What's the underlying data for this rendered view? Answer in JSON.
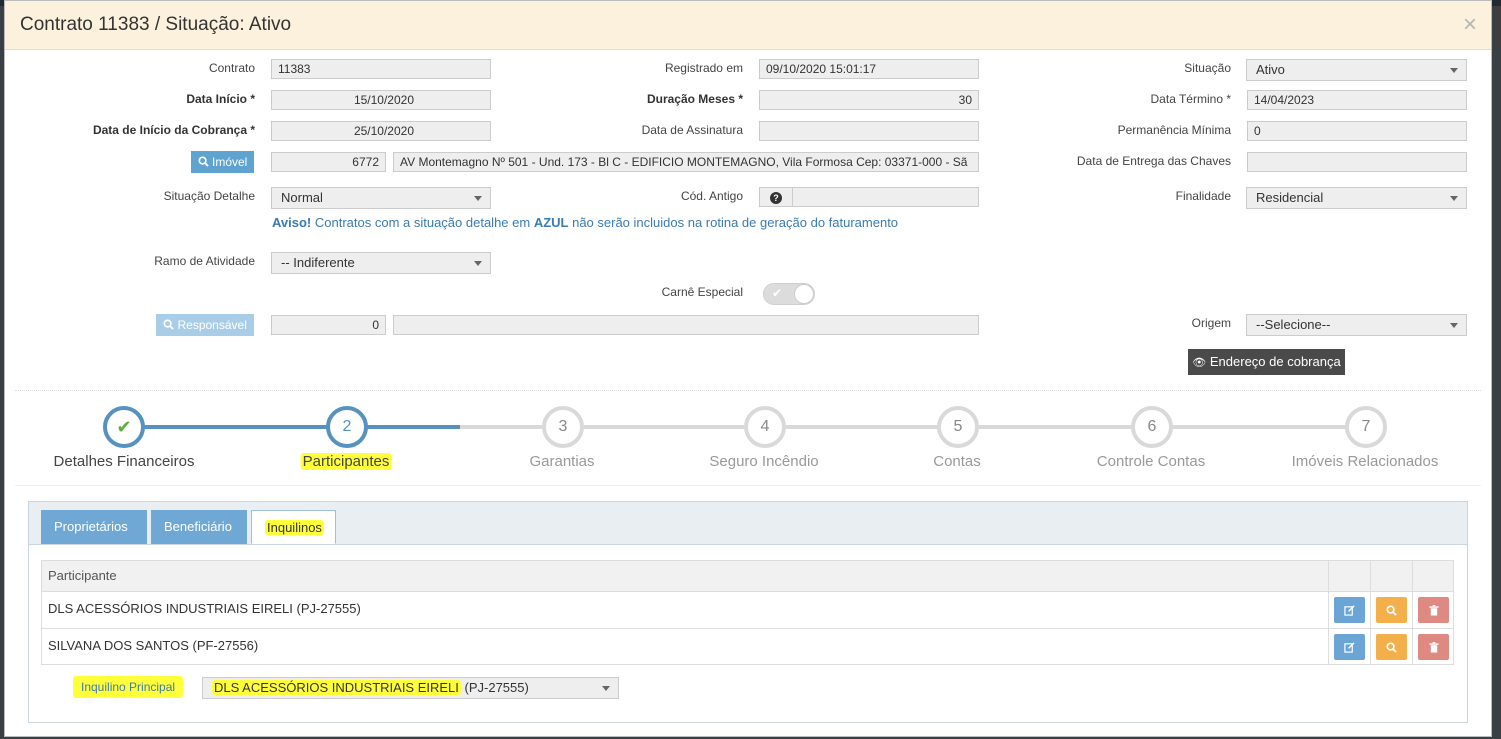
{
  "modal": {
    "title": "Contrato 11383 / Situação: Ativo",
    "close": "×"
  },
  "form": {
    "contrato": {
      "label": "Contrato",
      "value": "11383"
    },
    "registrado": {
      "label": "Registrado em",
      "value": "09/10/2020 15:01:17"
    },
    "situacao": {
      "label": "Situação",
      "value": "Ativo"
    },
    "data_inicio": {
      "label": "Data Início *",
      "value": "15/10/2020"
    },
    "duracao": {
      "label": "Duração Meses *",
      "value": "30"
    },
    "data_termino": {
      "label": "Data Término *",
      "value": "14/04/2023"
    },
    "inicio_cobranca": {
      "label": "Data de Início da Cobrança *",
      "value": "25/10/2020"
    },
    "data_assinatura": {
      "label": "Data de Assinatura",
      "value": ""
    },
    "permanencia": {
      "label": "Permanência Mínima",
      "value": "0"
    },
    "imovel": {
      "button": "Imóvel",
      "code": "6772",
      "address": "AV Montemagno Nº 501  - Und.  173 - Bl  C - EDIFICIO MONTEMAGNO, Vila Formosa Cep: 03371-000 - Sã"
    },
    "entrega_chaves": {
      "label": "Data de Entrega das Chaves",
      "value": ""
    },
    "situacao_detalhe": {
      "label": "Situação Detalhe",
      "value": "Normal"
    },
    "cod_antigo": {
      "label": "Cód. Antigo",
      "help": "?",
      "value": ""
    },
    "finalidade": {
      "label": "Finalidade",
      "value": "Residencial"
    },
    "aviso": {
      "prefix": "Aviso!",
      "text1": " Contratos com a situação detalhe em ",
      "azul": "AZUL",
      "text2": " não serão incluidos na rotina de geração do faturamento"
    },
    "ramo": {
      "label": "Ramo de Atividade",
      "value": "-- Indiferente"
    },
    "carne": {
      "label": "Carnê Especial",
      "checked": false
    },
    "responsavel": {
      "button": "Responsável",
      "code": "0",
      "name": ""
    },
    "origem": {
      "label": "Origem",
      "value": "--Selecione--"
    },
    "endereco_cobranca": "Endereço de cobrança"
  },
  "wizard": {
    "steps": [
      {
        "num": "✔",
        "label": "Detalhes Financeiros"
      },
      {
        "num": "2",
        "label": "Participantes"
      },
      {
        "num": "3",
        "label": "Garantias"
      },
      {
        "num": "4",
        "label": "Seguro Incêndio"
      },
      {
        "num": "5",
        "label": "Contas"
      },
      {
        "num": "6",
        "label": "Controle Contas"
      },
      {
        "num": "7",
        "label": "Imóveis Relacionados"
      }
    ]
  },
  "tabs": [
    "Proprietários",
    "Beneficiário",
    "Inquilinos"
  ],
  "table": {
    "header": "Participante",
    "rows": [
      {
        "name": "DLS ACESSÓRIOS INDUSTRIAIS EIRELI (PJ-27555)"
      },
      {
        "name": "SILVANA DOS SANTOS (PF-27556)"
      }
    ]
  },
  "inquilino_principal": {
    "label": "Inquilino Principal",
    "value_highlight": "DLS ACESSÓRIOS INDUSTRIAIS EIRELI",
    "value_rest": " (PJ-27555)"
  },
  "colors": {
    "accent": "#5592c0",
    "header_bg": "#fcf1dd",
    "highlight": "#ffff3a",
    "edit": "#6aa5d6",
    "view": "#f3b04a",
    "delete": "#de8a83"
  }
}
